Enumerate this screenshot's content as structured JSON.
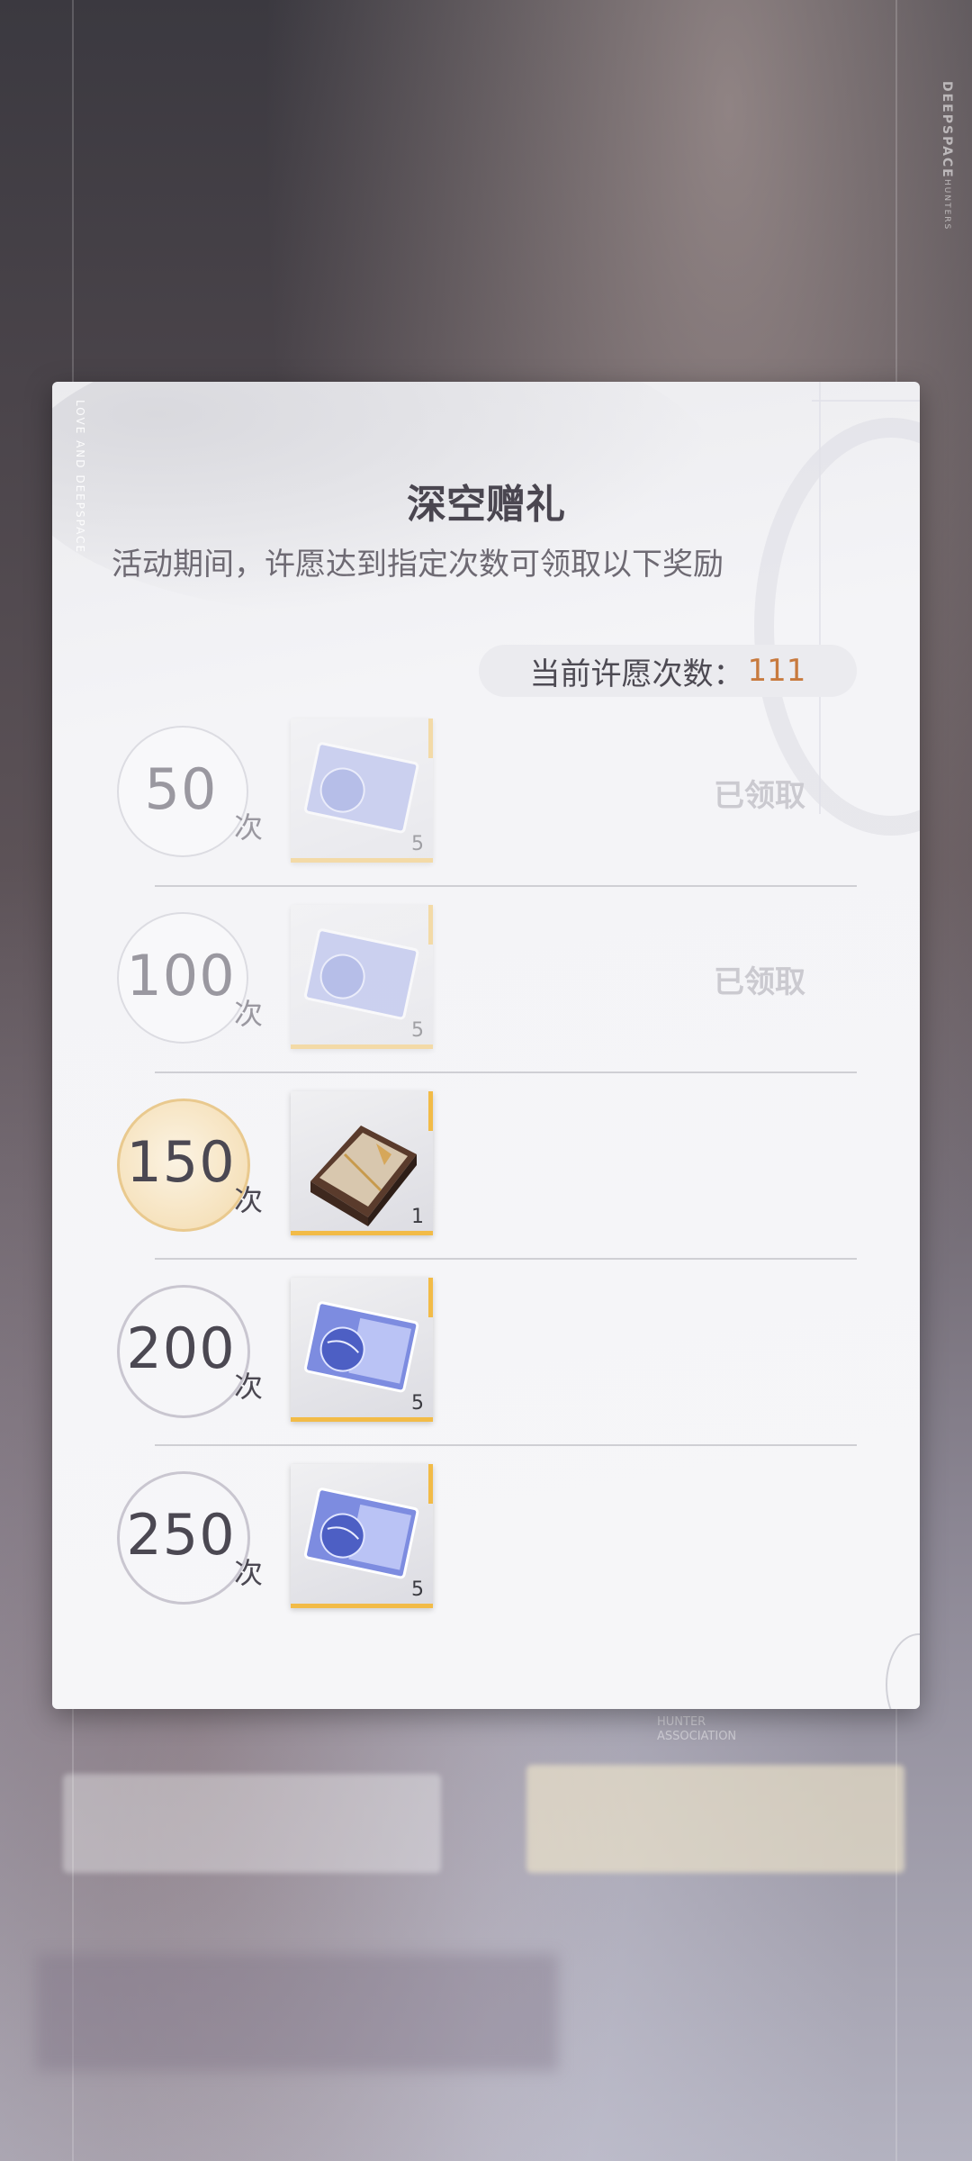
{
  "background": {
    "deepspace": "DEEPSPACE",
    "hunters": "HUNTERS",
    "hunter_association": "HUNTER\nASSOCIATION"
  },
  "dialog": {
    "side_text": "LOVE AND DEEPSPACE",
    "title": "深空赠礼",
    "subtitle": "活动期间，许愿达到指定次数可领取以下奖励",
    "count_label": "当前许愿次数：",
    "count_value": "111",
    "unit": "次",
    "claimed_label": "已领取",
    "rewards": [
      {
        "threshold": "50",
        "quantity": "5",
        "item_icon": "deepspace-ticket-icon",
        "status": "claimed"
      },
      {
        "threshold": "100",
        "quantity": "5",
        "item_icon": "deepspace-ticket-icon",
        "status": "claimed"
      },
      {
        "threshold": "150",
        "quantity": "1",
        "item_icon": "gift-box-icon",
        "status": "locked"
      },
      {
        "threshold": "200",
        "quantity": "5",
        "item_icon": "deepspace-ticket-icon",
        "status": "locked"
      },
      {
        "threshold": "250",
        "quantity": "5",
        "item_icon": "deepspace-ticket-icon",
        "status": "locked"
      }
    ]
  },
  "colors": {
    "accent_gold": "#f2bb47",
    "count_highlight": "#c87a3e"
  }
}
